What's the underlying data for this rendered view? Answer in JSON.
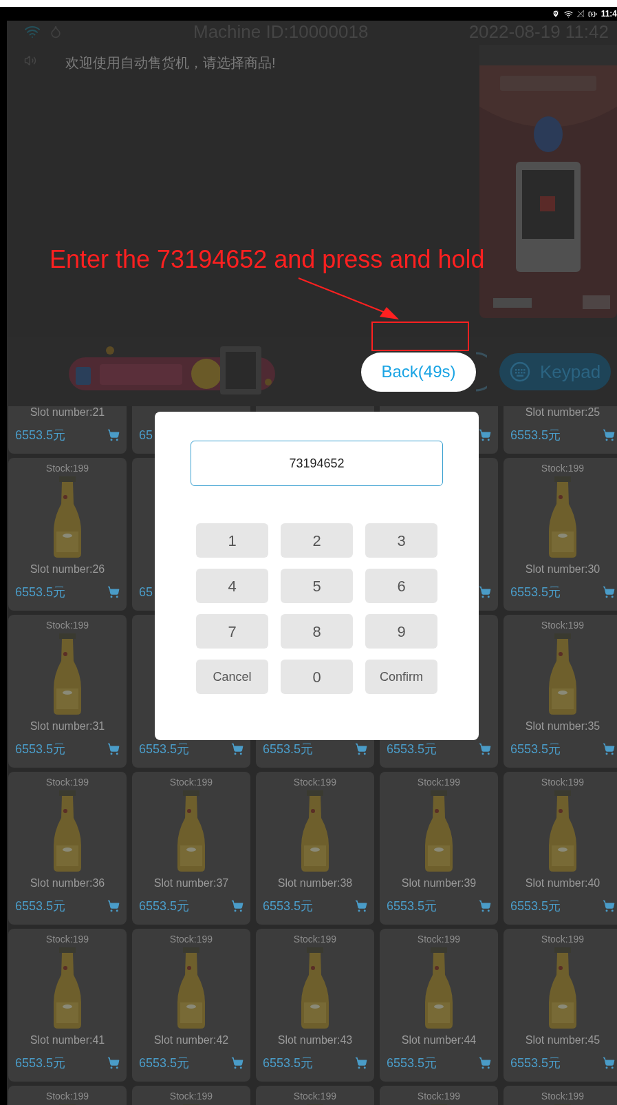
{
  "status_bar": {
    "time": "11:4"
  },
  "header": {
    "machine_id": "Machine ID:10000018",
    "datetime": "2022-08-19 11:42"
  },
  "notice": "欢迎使用自动售货机，请选择商品!",
  "back_button": {
    "label": "Back(49s)"
  },
  "keypad_button": {
    "label": "Keypad"
  },
  "product_rows": [
    [
      {
        "kind": "plain",
        "slot": "Slot number:21",
        "price": "6553.5元",
        "cart": true
      },
      {
        "kind": "plain",
        "price": "65",
        "cart": false
      },
      {
        "kind": "plain",
        "cart": false
      },
      {
        "kind": "plain",
        "cart": true
      },
      {
        "kind": "plain",
        "slot": "Slot number:25",
        "price": "6553.5元",
        "cart": true
      }
    ],
    [
      {
        "kind": "product",
        "stock": "Stock:199",
        "slot": "Slot number:26",
        "price": "6553.5元",
        "cart": true
      },
      {
        "kind": "plain",
        "price": "65",
        "cart": false
      },
      {
        "kind": "hidden"
      },
      {
        "kind": "plain",
        "cart": true
      },
      {
        "kind": "product",
        "stock": "Stock:199",
        "slot": "Slot number:30",
        "price": "6553.5元",
        "cart": true
      }
    ],
    [
      {
        "kind": "product",
        "stock": "Stock:199",
        "slot": "Slot number:31",
        "price": "6553.5元",
        "cart": true
      },
      {
        "kind": "plain",
        "price": "6553.5元",
        "cart": true
      },
      {
        "kind": "plain",
        "price": "6553.5元",
        "cart": true
      },
      {
        "kind": "plain",
        "price": "6553.5元",
        "cart": true
      },
      {
        "kind": "product",
        "stock": "Stock:199",
        "slot": "Slot number:35",
        "price": "6553.5元",
        "cart": true
      }
    ],
    [
      {
        "kind": "product",
        "stock": "Stock:199",
        "slot": "Slot number:36",
        "price": "6553.5元",
        "cart": true
      },
      {
        "kind": "product",
        "stock": "Stock:199",
        "slot": "Slot number:37",
        "price": "6553.5元",
        "cart": true
      },
      {
        "kind": "product",
        "stock": "Stock:199",
        "slot": "Slot number:38",
        "price": "6553.5元",
        "cart": true
      },
      {
        "kind": "product",
        "stock": "Stock:199",
        "slot": "Slot number:39",
        "price": "6553.5元",
        "cart": true
      },
      {
        "kind": "product",
        "stock": "Stock:199",
        "slot": "Slot number:40",
        "price": "6553.5元",
        "cart": true
      }
    ],
    [
      {
        "kind": "product",
        "stock": "Stock:199",
        "slot": "Slot number:41",
        "price": "6553.5元",
        "cart": true
      },
      {
        "kind": "product",
        "stock": "Stock:199",
        "slot": "Slot number:42",
        "price": "6553.5元",
        "cart": true
      },
      {
        "kind": "product",
        "stock": "Stock:199",
        "slot": "Slot number:43",
        "price": "6553.5元",
        "cart": true
      },
      {
        "kind": "product",
        "stock": "Stock:199",
        "slot": "Slot number:44",
        "price": "6553.5元",
        "cart": true
      },
      {
        "kind": "product",
        "stock": "Stock:199",
        "slot": "Slot number:45",
        "price": "6553.5元",
        "cart": true
      }
    ],
    [
      {
        "kind": "product",
        "stock": "Stock:199",
        "cart": false
      },
      {
        "kind": "product",
        "stock": "Stock:199",
        "cart": false
      },
      {
        "kind": "product",
        "stock": "Stock:199",
        "cart": false
      },
      {
        "kind": "product",
        "stock": "Stock:199",
        "cart": false
      },
      {
        "kind": "product",
        "stock": "Stock:199",
        "cart": false
      }
    ]
  ],
  "dialog": {
    "value": "73194652",
    "keys": [
      {
        "label": "1",
        "kind": "digit"
      },
      {
        "label": "2",
        "kind": "digit"
      },
      {
        "label": "3",
        "kind": "digit"
      },
      {
        "label": "4",
        "kind": "digit"
      },
      {
        "label": "5",
        "kind": "digit"
      },
      {
        "label": "6",
        "kind": "digit"
      },
      {
        "label": "7",
        "kind": "digit"
      },
      {
        "label": "8",
        "kind": "digit"
      },
      {
        "label": "9",
        "kind": "digit"
      },
      {
        "label": "Cancel",
        "kind": "action"
      },
      {
        "label": "0",
        "kind": "digit"
      },
      {
        "label": "Confirm",
        "kind": "action"
      }
    ]
  },
  "annotation": {
    "text": "Enter the 73194652 and press and hold"
  }
}
